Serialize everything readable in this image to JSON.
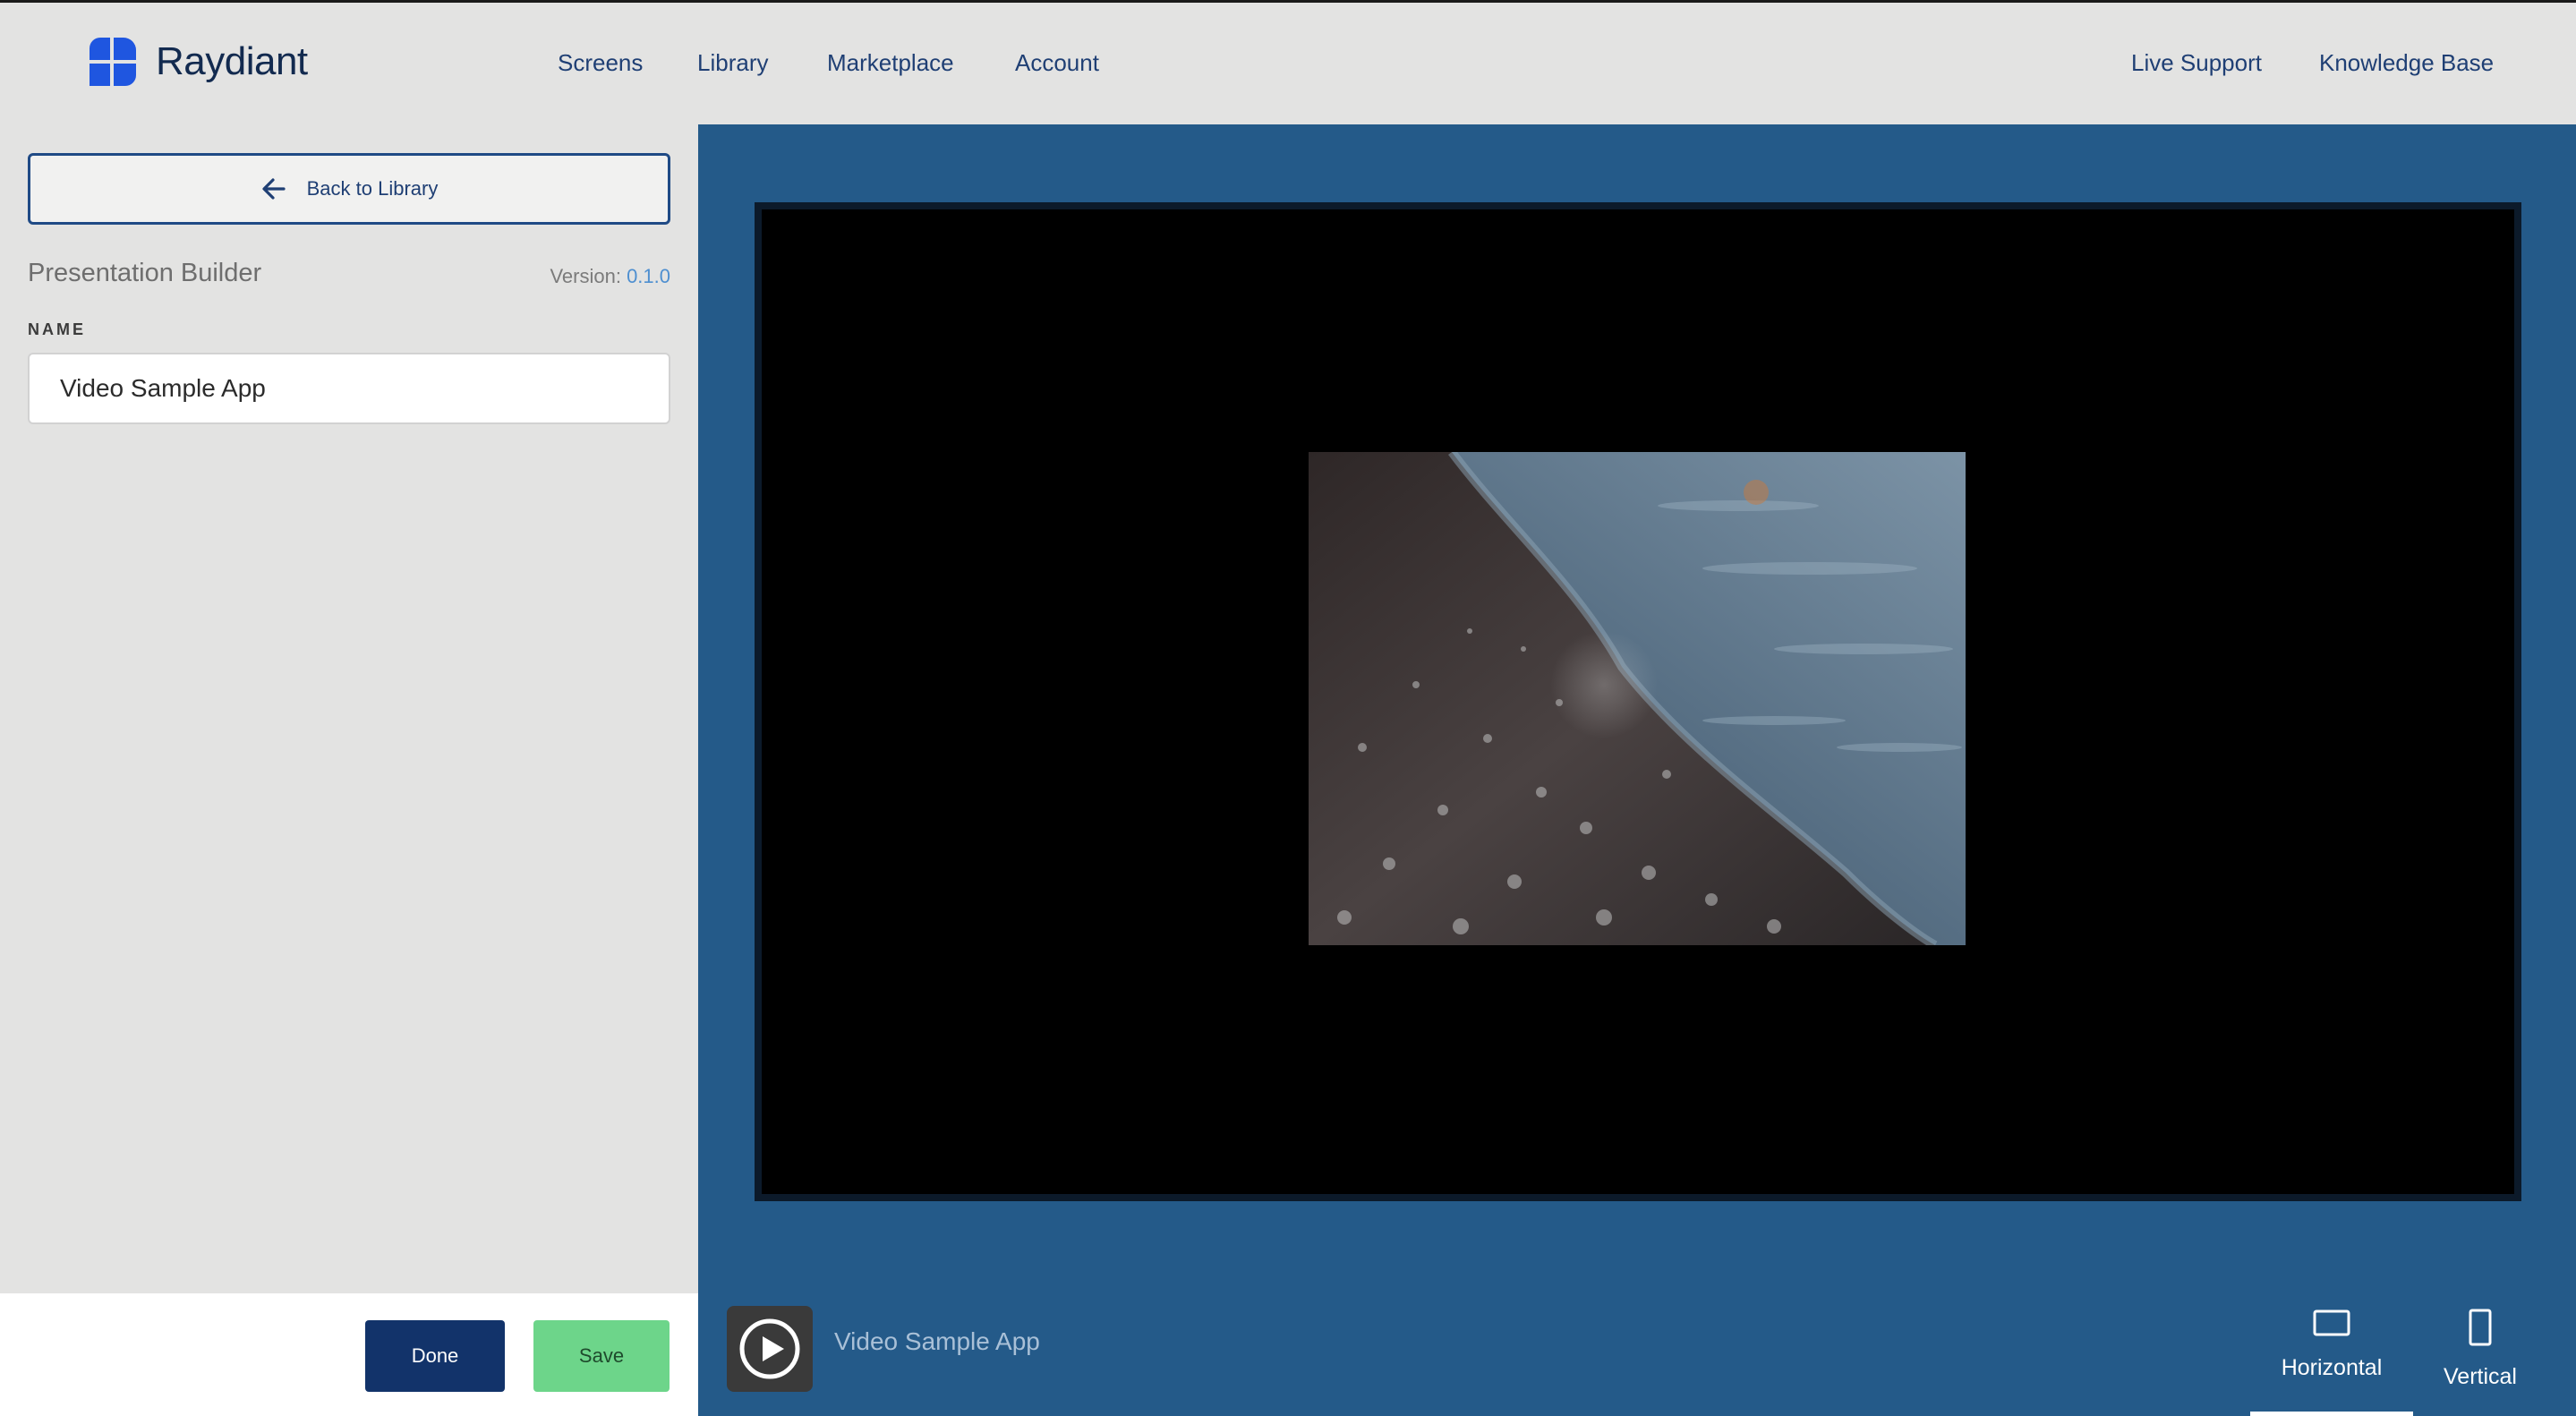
{
  "brand": {
    "name": "Raydiant",
    "logo_color": "#1f56e0"
  },
  "nav": {
    "left": [
      "Screens",
      "Library",
      "Marketplace",
      "Account"
    ],
    "right": [
      "Live Support",
      "Knowledge Base"
    ]
  },
  "sidebar": {
    "back_label": "Back to Library",
    "title": "Presentation Builder",
    "version_prefix": "Version:",
    "version_number": "0.1.0",
    "name_label": "NAME",
    "name_value": "Video Sample App"
  },
  "footer": {
    "done_label": "Done",
    "save_label": "Save"
  },
  "preview": {
    "app_name": "Video Sample App",
    "orientation_options": [
      "Horizontal",
      "Vertical"
    ],
    "selected_orientation": "Horizontal"
  },
  "colors": {
    "accent_blue": "#12336a",
    "save_green": "#6dd58a",
    "preview_bg": "#245a89"
  }
}
